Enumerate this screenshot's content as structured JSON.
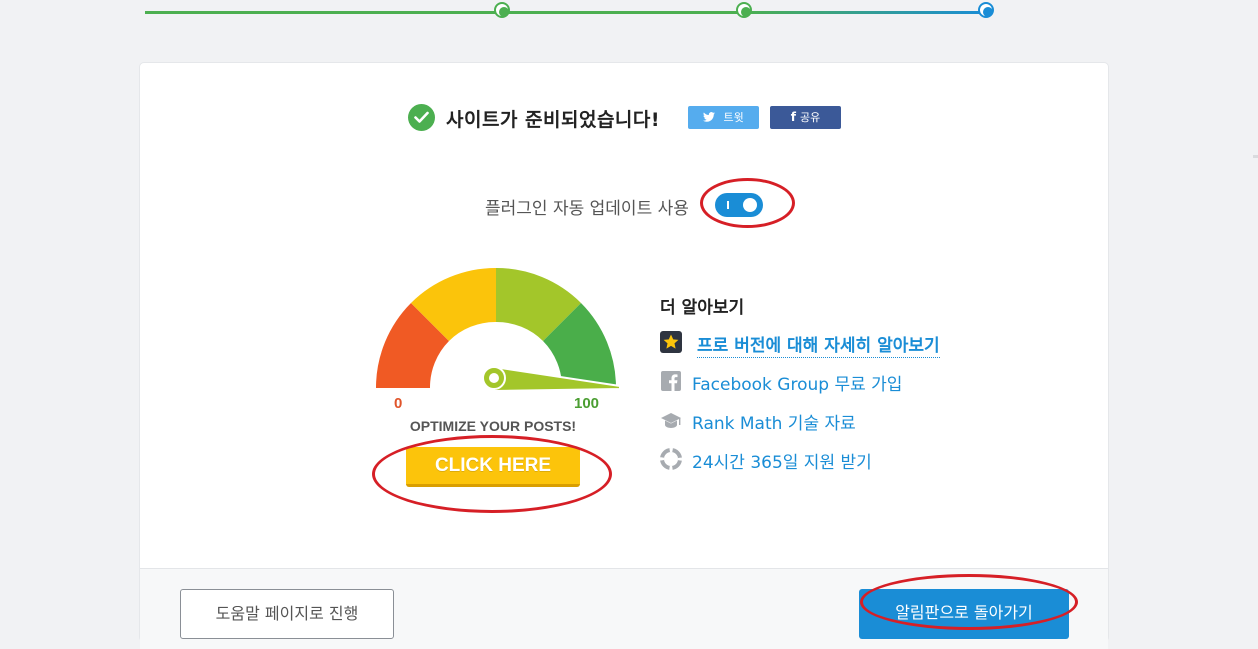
{
  "stepper": {
    "steps_done": 2,
    "steps_total": 3,
    "done_color": "#4caf50",
    "active_color": "#1a8dd6"
  },
  "heading": {
    "title": "사이트가 준비되었습니다!",
    "tweet_label": "트윗",
    "share_label": "공유",
    "tweet_icon": "twitter-icon",
    "share_icon": "facebook-icon"
  },
  "auto_update": {
    "label": "플러그인 자동 업데이트 사용",
    "enabled": true
  },
  "promo": {
    "min": "0",
    "max": "100",
    "caption": "OPTIMIZE YOUR POSTS!",
    "cta": "CLICK HERE",
    "gauge_colors": [
      "#f05a24",
      "#fbc40b",
      "#a3c62a",
      "#4aae4a"
    ]
  },
  "learn_more": {
    "title": "더 알아보기",
    "items": [
      {
        "icon": "star-icon",
        "label": "프로 버전에 대해 자세히 알아보기"
      },
      {
        "icon": "facebook-icon",
        "label": "Facebook Group 무료 가입"
      },
      {
        "icon": "graduation-cap-icon",
        "label": "Rank Math 기술 자료"
      },
      {
        "icon": "lifebuoy-icon",
        "label": "24시간 365일 지원 받기"
      }
    ]
  },
  "footer": {
    "help_button": "도움말 페이지로 진행",
    "dashboard_button": "알림판으로 돌아가기"
  },
  "colors": {
    "accent": "#1a8dd6",
    "success": "#4caf50",
    "annotation": "#d61f26",
    "cta": "#fcc40b"
  }
}
